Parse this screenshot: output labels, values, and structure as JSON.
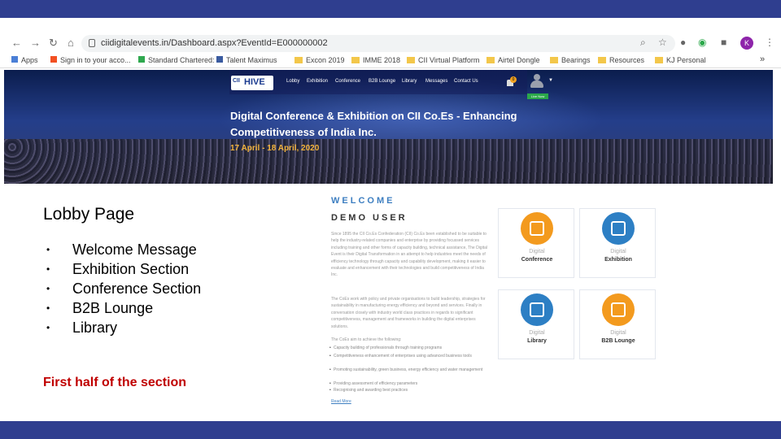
{
  "browser": {
    "url": "ciidigitalevents.in/Dashboard.aspx?EventId=E000000002",
    "bookmarks": [
      "Apps",
      "Sign in to your acco...",
      "Standard Chartered:",
      "Talent Maximus",
      "Excon 2019",
      "IMME 2018",
      "CII Virtual Platform",
      "Airtel Dongle",
      "Bearings",
      "Resources",
      "KJ Personal"
    ],
    "more_bookmarks": "»",
    "profile_initial": "K"
  },
  "site": {
    "logo_cii": "CII",
    "logo_hive": "HIVE",
    "nav": [
      "Lobby",
      "Exhibition",
      "Conference",
      "B2B Lounge",
      "Library",
      "Messages",
      "Contact Us"
    ],
    "notification_count": "0",
    "live_badge": "Live Now",
    "banner_title": "Digital Conference & Exhibition on CII Co.Es - Enhancing Competitiveness of India Inc.",
    "banner_date": "17 April - 18 April, 2020"
  },
  "slide": {
    "title": "Lobby Page",
    "bullets": [
      "Welcome Message",
      "Exhibition Section",
      "Conference Section",
      "B2B Lounge",
      "Library"
    ],
    "bullet_symbol": "•",
    "footer_note": "First half of the section"
  },
  "welcome": {
    "heading": "WELCOME",
    "user": "DEMO USER",
    "paragraphs": [
      "Since 1895 the CII Co.Es Confederation (CII) Co.Es been established to be suitable to help the industry-related companies and enterprise by providing focussed services including training and other forms of capacity building, technical assistance, The Digital Event is their Digital Transformation in an attempt to help industries meet the needs of efficiency technology through capacity and capability development, making it easier to evaluate and enhancement with their technologies and build competitiveness of India Inc.",
      "The CoEs work with policy and private organisations to build leadership, strategies for sustainability in manufacturing energy efficiency and beyond and services. Finally in conversation closely with industry world class practices in regards to significant competitiveness, management and frameworks in building the digital enterprises solutions.",
      "The CoEs aim to achieve the following:"
    ],
    "list": [
      "Capacity building of professionals through training programs",
      "Competitiveness enhancement of enterprises using advanced business tools",
      "Promoting sustainability, green business, energy efficiency and water management",
      "Providing assessment of efficiency parameters",
      "Recognising and awarding best practices"
    ],
    "read_more": "Read More"
  },
  "cards": [
    {
      "top": "Digital",
      "bottom": "Conference",
      "icon": "conference-icon",
      "color": "#f39a1e"
    },
    {
      "top": "Digital",
      "bottom": "Exhibition",
      "icon": "exhibition-icon",
      "color": "#2d7fc4"
    },
    {
      "top": "Digital",
      "bottom": "Library",
      "icon": "library-icon",
      "color": "#2d7fc4"
    },
    {
      "top": "Digital",
      "bottom": "B2B Lounge",
      "icon": "handshake-icon",
      "color": "#f39a1e"
    }
  ]
}
